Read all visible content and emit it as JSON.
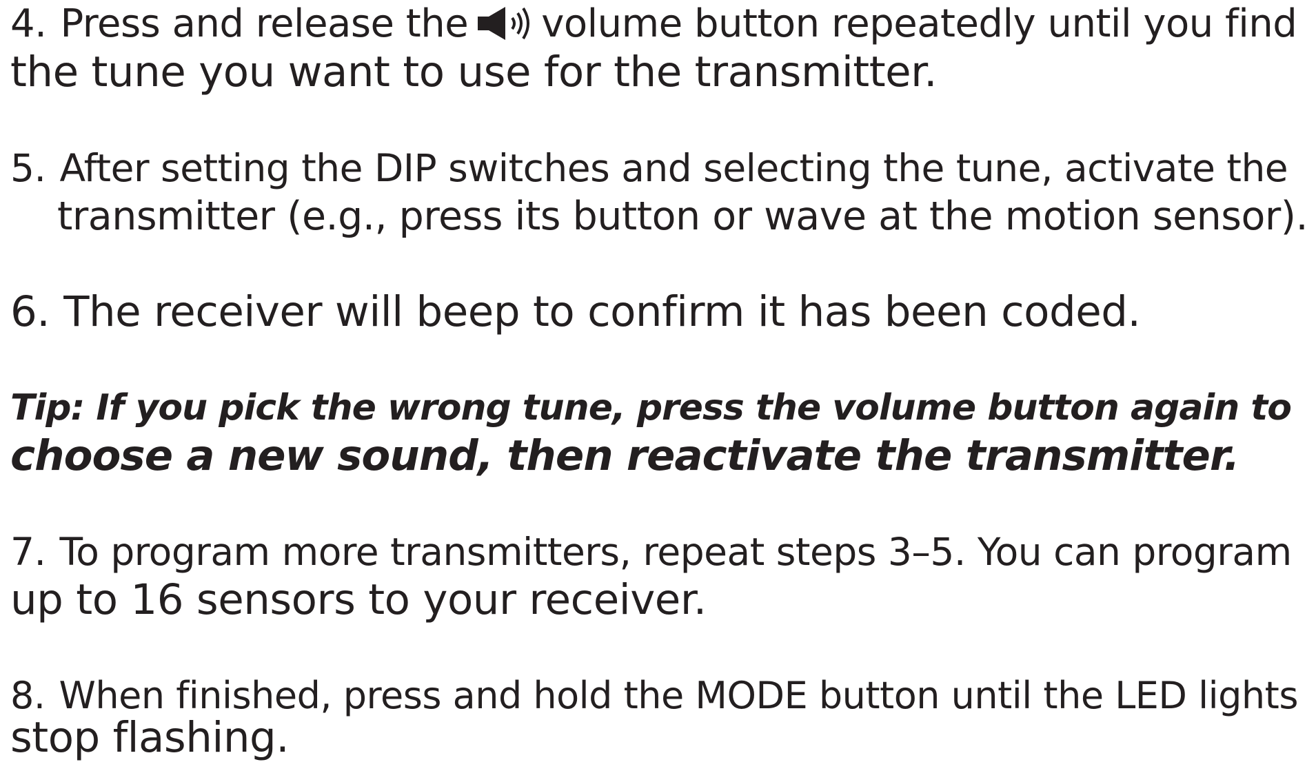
{
  "steps": [
    {
      "number": "4.",
      "line1_before_icon": "Press and release the",
      "icon": "speaker-volume-icon",
      "line1_after_icon": "volume button repeatedly until you find",
      "line2": "the tune you want to use for the transmitter."
    },
    {
      "number": "5.",
      "line1": "After setting the DIP switches and selecting the tune,  activate the",
      "line2": "transmitter (e.g., press its button or wave at the motion sensor)."
    },
    {
      "number": "6.",
      "line1": "The receiver will beep to confirm it has been coded."
    },
    {
      "number": "7.",
      "line1": "To program more transmitters, repeat steps 3–5.  You can program",
      "line2": "up to 16 sensors to your receiver."
    },
    {
      "number": "8.",
      "line1": "When finished, press and hold the MODE button until the LED lights",
      "line2": "stop flashing."
    }
  ],
  "tip": {
    "line1": "Tip: If you pick the wrong tune, press the volume button again to",
    "line2": "choose a new sound, then reactivate the transmitter."
  },
  "colors": {
    "text": "#231f20",
    "background": "#ffffff"
  }
}
